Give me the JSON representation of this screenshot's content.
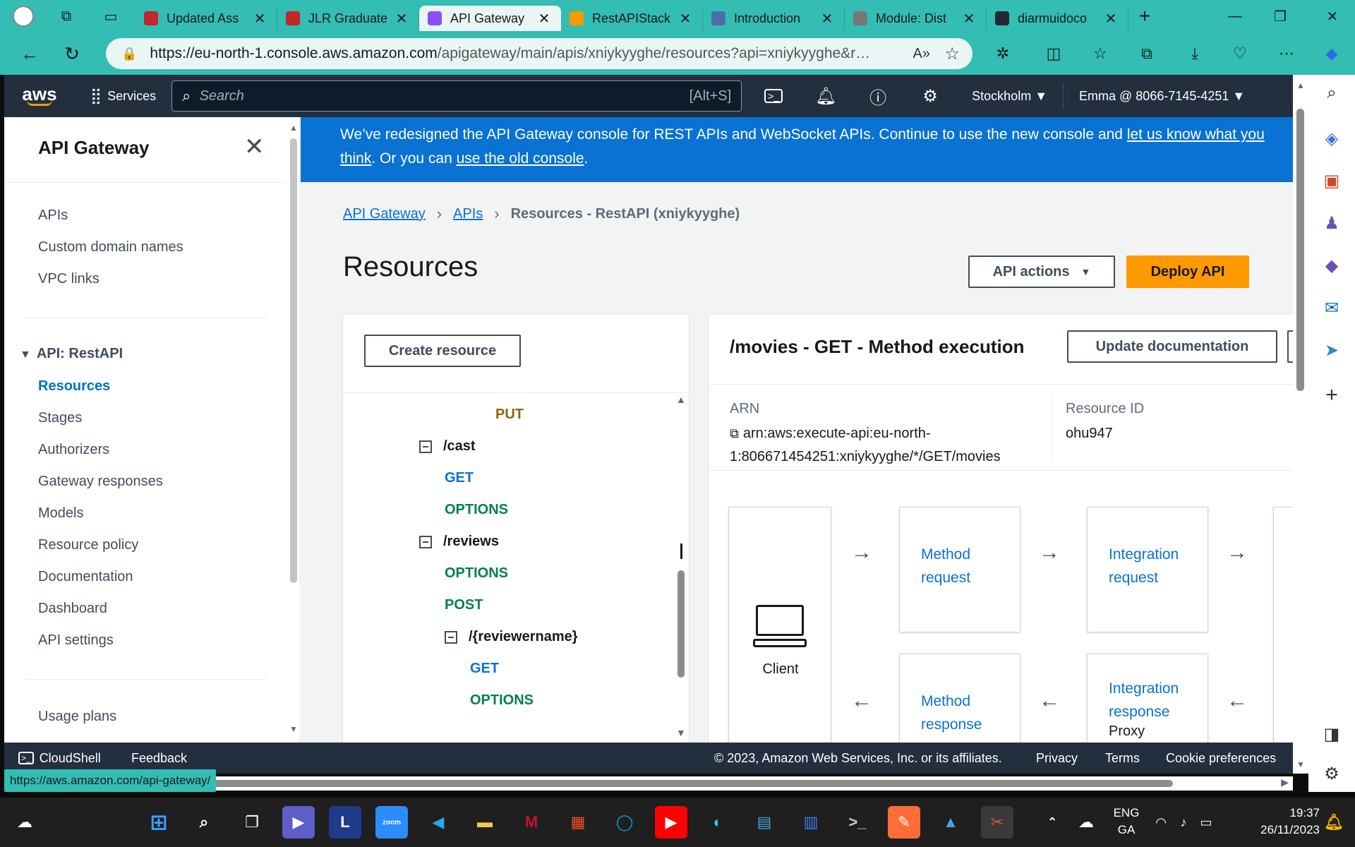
{
  "browser": {
    "tabs": [
      {
        "title": "Updated Ass",
        "favicon_color": "#c1272d"
      },
      {
        "title": "JLR Graduate",
        "favicon_color": "#c1272d"
      },
      {
        "title": "API Gateway",
        "favicon_color": "#8c4fff",
        "active": true
      },
      {
        "title": "RestAPIStack",
        "favicon_color": "#ff9900"
      },
      {
        "title": "Introduction",
        "favicon_color": "#4a6fa5"
      },
      {
        "title": "Module: Dist",
        "favicon_color": "#777777"
      },
      {
        "title": "diarmuidoco",
        "favicon_color": "#24292f"
      }
    ],
    "url_host": "https://eu-north-1.console.aws.amazon.com",
    "url_path": "/apigateway/main/apis/xniykyyghe/resources?api=xniykyyghe&r…",
    "status_url": "https://aws.amazon.com/api-gateway/"
  },
  "aws_nav": {
    "logo": "aws",
    "services": "Services",
    "search_placeholder": "Search",
    "search_shortcut": "[Alt+S]",
    "region": "Stockholm ▼",
    "account": "Emma @ 8066-7145-4251 ▼"
  },
  "sidenav": {
    "title": "API Gateway",
    "top_items": [
      "APIs",
      "Custom domain names",
      "VPC links"
    ],
    "group_label": "API: RestAPI",
    "group_items": [
      "Resources",
      "Stages",
      "Authorizers",
      "Gateway responses",
      "Models",
      "Resource policy",
      "Documentation",
      "Dashboard",
      "API settings"
    ],
    "bottom_items": [
      "Usage plans"
    ]
  },
  "banner": {
    "text1": "We’ve redesigned the API Gateway console for REST APIs and WebSocket APIs. Continue to use the new console and ",
    "link1": "let us know what you think",
    "text2": ". Or you can ",
    "link2": "use the old console",
    "text3": "."
  },
  "breadcrumbs": {
    "c1": "API Gateway",
    "c2": "APIs",
    "current": "Resources - RestAPI (xniykyyghe)"
  },
  "page": {
    "title": "Resources",
    "api_actions": "API actions",
    "deploy": "Deploy API",
    "create_resource": "Create resource"
  },
  "tree": [
    {
      "label": "PUT",
      "kind": "put"
    },
    {
      "label": "/cast",
      "kind": "res"
    },
    {
      "label": "GET",
      "kind": "get"
    },
    {
      "label": "OPTIONS",
      "kind": "opt"
    },
    {
      "label": "/reviews",
      "kind": "res"
    },
    {
      "label": "OPTIONS",
      "kind": "opt"
    },
    {
      "label": "POST",
      "kind": "post"
    },
    {
      "label": "/{reviewername}",
      "kind": "res"
    },
    {
      "label": "GET",
      "kind": "get"
    },
    {
      "label": "OPTIONS",
      "kind": "opt"
    }
  ],
  "exec": {
    "title": "/movies - GET - Method execution",
    "update_doc": "Update documentation",
    "arn_label": "ARN",
    "arn_line1": "arn:aws:execute-api:eu-north-",
    "arn_line2": "1:806671454251:xniykyyghe/*/GET/movies",
    "rid_label": "Resource ID",
    "rid_value": "ohu947",
    "client": "Client",
    "method_request_1": "Method",
    "method_request_2": "request",
    "integration_request_1": "Integration",
    "integration_request_2": "request",
    "method_response_1": "Method",
    "method_response_2": "response",
    "integration_response_1": "Integration",
    "integration_response_2": "response",
    "proxy": "Proxy"
  },
  "footer": {
    "cloudshell": "CloudShell",
    "feedback": "Feedback",
    "copyright": "© 2023, Amazon Web Services, Inc. or its affiliates.",
    "privacy": "Privacy",
    "terms": "Terms",
    "cookies": "Cookie preferences"
  },
  "taskbar": {
    "lang1": "ENG",
    "lang2": "GA",
    "time": "19:37",
    "date": "26/11/2023"
  }
}
